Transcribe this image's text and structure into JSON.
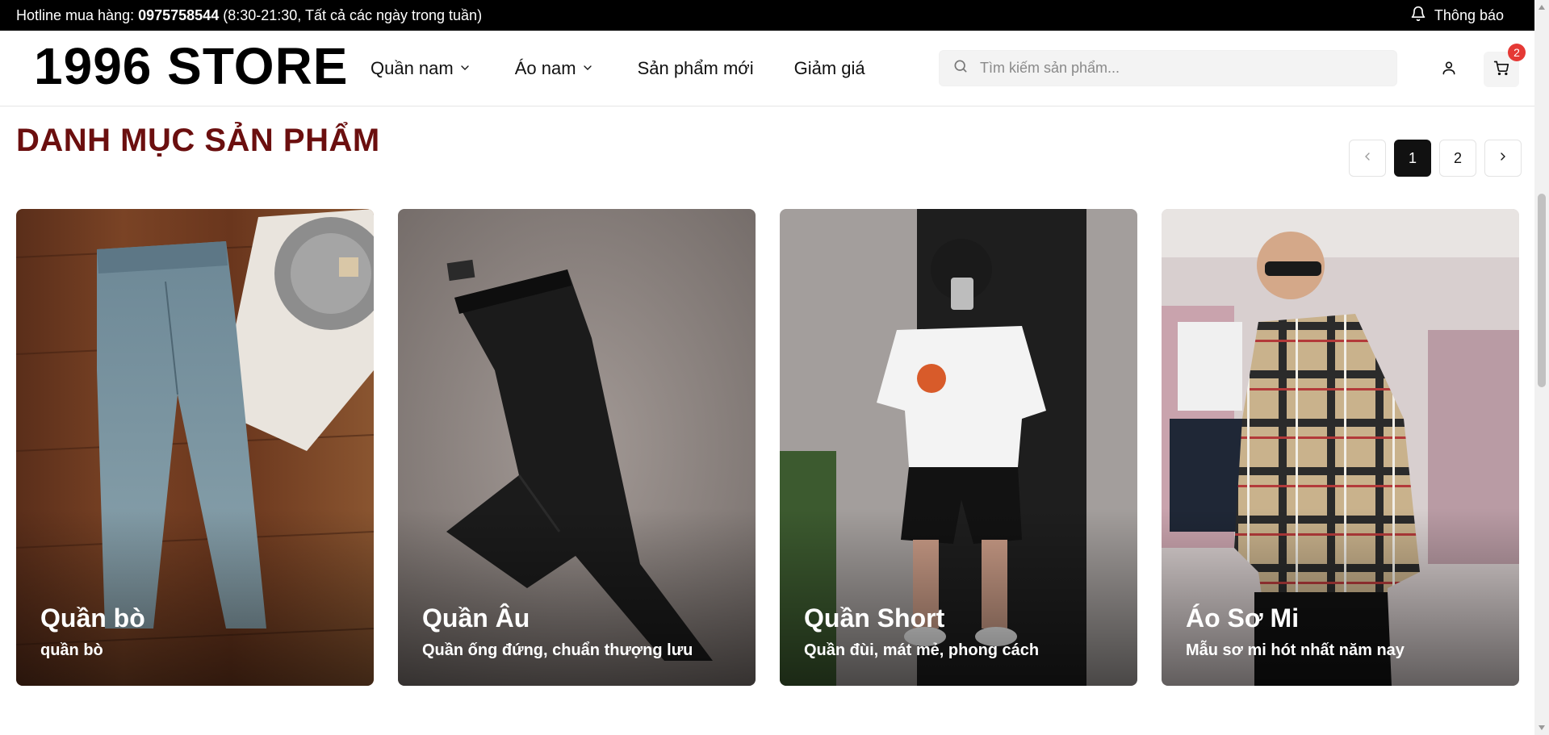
{
  "topbar": {
    "hotline_label": "Hotline mua hàng: ",
    "hotline_number": "0975758544",
    "hotline_hours": " (8:30-21:30, Tất cả các ngày trong tuần)",
    "notification_label": "Thông báo"
  },
  "header": {
    "logo": "1996 STORE",
    "nav": [
      {
        "label": "Quần nam",
        "has_dropdown": true
      },
      {
        "label": "Áo nam",
        "has_dropdown": true
      },
      {
        "label": "Sản phẩm mới",
        "has_dropdown": false
      },
      {
        "label": "Giảm giá",
        "has_dropdown": false
      }
    ],
    "search_placeholder": "Tìm kiếm sản phẩm...",
    "cart_count": "2",
    "icons": {
      "search": "search-icon",
      "user": "user-icon",
      "cart": "cart-icon",
      "bell": "bell-icon"
    }
  },
  "section": {
    "title": "DANH MỤC SẢN PHẨM",
    "pages": [
      "1",
      "2"
    ],
    "active_page": "1"
  },
  "categories": [
    {
      "name": "Quần bò",
      "desc": "quần bò",
      "image": "jeans-photo"
    },
    {
      "name": "Quần Âu",
      "desc": "Quần ống đứng, chuẩn thượng lưu",
      "image": "trousers-photo"
    },
    {
      "name": "Quần Short",
      "desc": "Quần đùi, mát mẻ, phong cách",
      "image": "shorts-photo"
    },
    {
      "name": "Áo Sơ Mi",
      "desc": "Mẫu sơ mi hót nhất năm nay",
      "image": "shirt-photo"
    }
  ],
  "colors": {
    "topbar_bg": "#000000",
    "section_title": "#6b0f0f",
    "active_page_bg": "#111111",
    "cart_badge": "#e53935"
  }
}
